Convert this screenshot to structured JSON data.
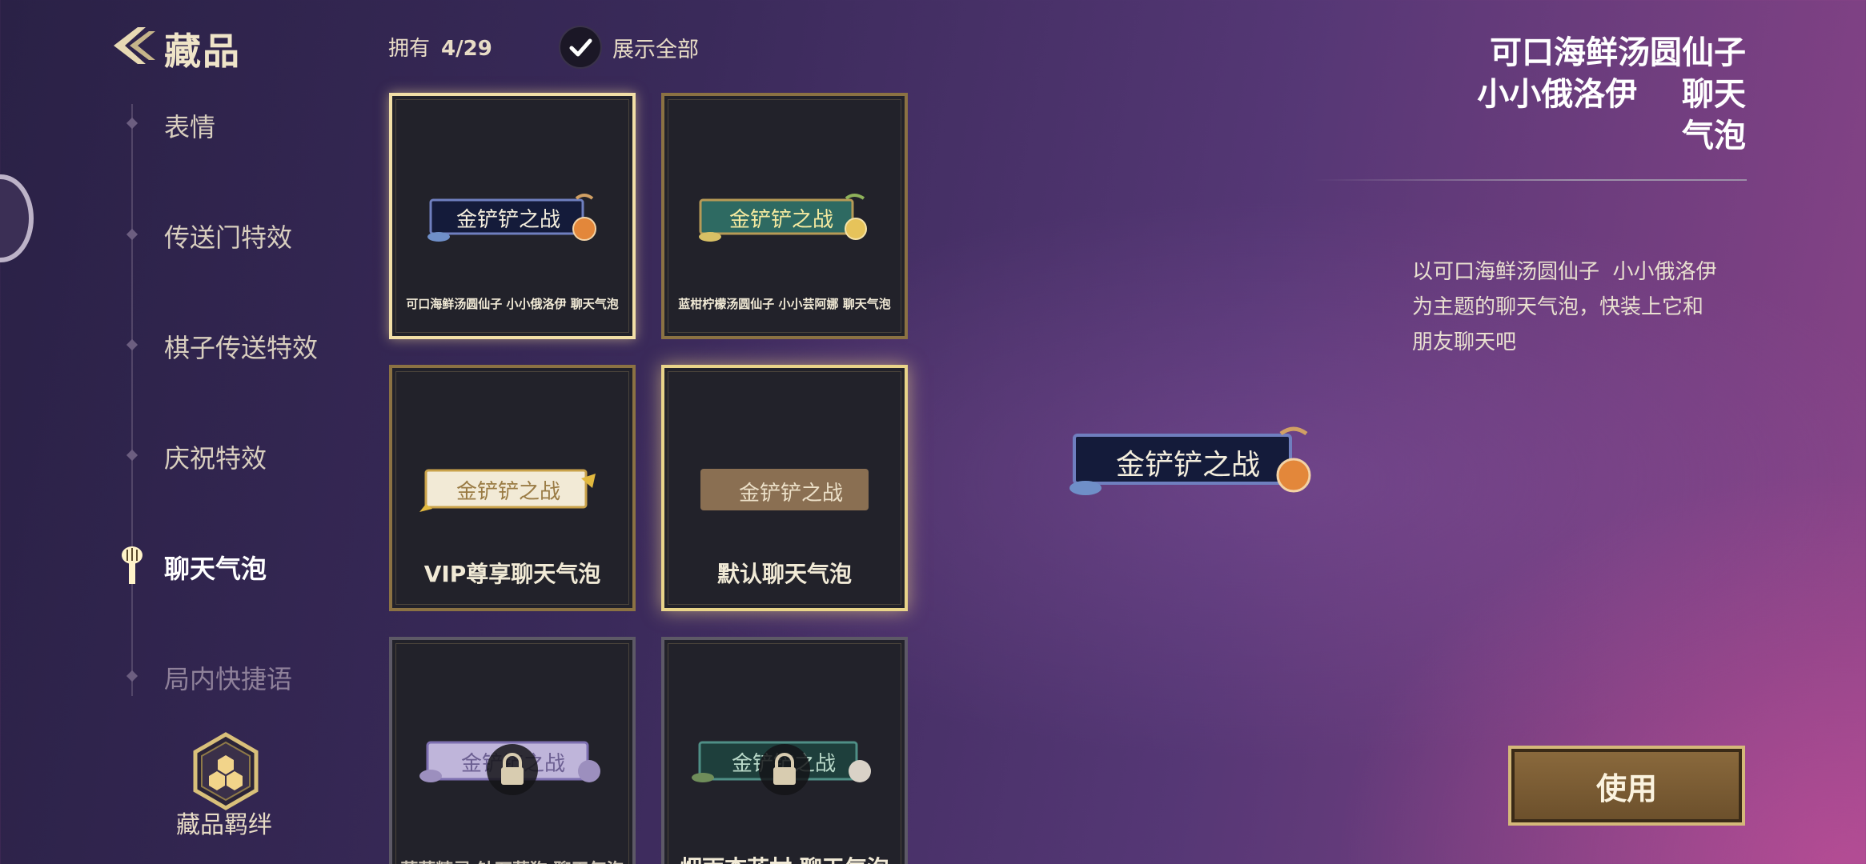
{
  "header": {
    "title": "藏品"
  },
  "nav": {
    "items": [
      {
        "label": "表情",
        "state": "normal"
      },
      {
        "label": "传送门特效",
        "state": "normal"
      },
      {
        "label": "棋子传送特效",
        "state": "normal"
      },
      {
        "label": "庆祝特效",
        "state": "normal"
      },
      {
        "label": "聊天气泡",
        "state": "active"
      },
      {
        "label": "局内快捷语",
        "state": "dim"
      }
    ],
    "bond_label": "藏品羁绊"
  },
  "toolbar": {
    "owned_label": "拥有",
    "owned_count": "4/29",
    "show_all_label": "展示全部",
    "show_all_checked": true
  },
  "cards": [
    {
      "bubble_text": "金铲铲之战",
      "name": "可口海鲜汤圆仙子  小小俄洛伊    聊天气泡",
      "style": "navy",
      "selected": true,
      "locked": false
    },
    {
      "bubble_text": "金铲铲之战",
      "name": "蓝柑柠檬汤圆仙子  小小芸阿娜  聊天气泡",
      "style": "teal",
      "selected": false,
      "locked": false
    },
    {
      "bubble_text": "金铲铲之战",
      "name": "VIP尊享聊天气泡",
      "style": "cream",
      "selected": false,
      "locked": false
    },
    {
      "bubble_text": "金铲铲之战",
      "name": "默认聊天气泡",
      "style": "brown",
      "selected": false,
      "locked": false,
      "is_default": true
    },
    {
      "bubble_text": "金铲铲之战",
      "name": "蔬菜精灵  钻石菜狗  聊天气泡",
      "style": "lavender",
      "selected": false,
      "locked": true
    },
    {
      "bubble_text": "金铲铲之战",
      "name": "烟雨杏花村  聊天气泡",
      "style": "darkteal",
      "selected": false,
      "locked": true
    }
  ],
  "detail": {
    "title_lines": [
      "可口海鲜汤圆仙子",
      "小小俄洛伊    聊天",
      "气泡"
    ],
    "description_lines": [
      "以可口海鲜汤圆仙子  小小俄洛伊",
      "为主题的聊天气泡，快装上它和",
      "朋友聊天吧"
    ],
    "preview_bubble_text": "金铲铲之战",
    "use_button_label": "使用"
  },
  "colors": {
    "accent_gold": "#d4b879",
    "card_border": "#8b7243",
    "selected_border": "#f2dfa6"
  }
}
